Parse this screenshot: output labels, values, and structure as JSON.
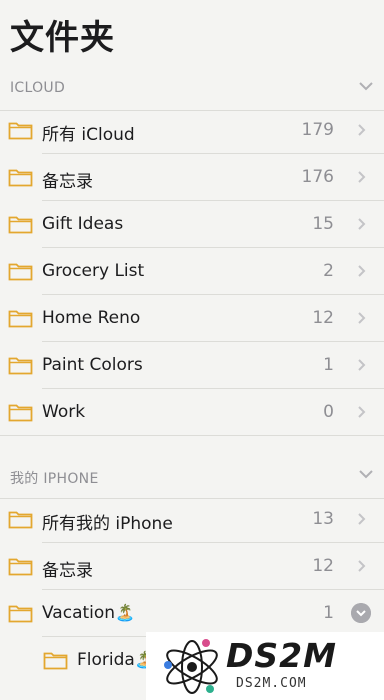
{
  "page": {
    "title": "文件夹"
  },
  "sections": [
    {
      "header": "ICLOUD",
      "folders": [
        {
          "name": "所有 iCloud",
          "count": "179"
        },
        {
          "name": "备忘录",
          "count": "176"
        },
        {
          "name": "Gift Ideas",
          "count": "15"
        },
        {
          "name": "Grocery List",
          "count": "2"
        },
        {
          "name": "Home Reno",
          "count": "12"
        },
        {
          "name": "Paint Colors",
          "count": "1"
        },
        {
          "name": "Work",
          "count": "0"
        }
      ]
    },
    {
      "header": "我的 IPHONE",
      "folders": [
        {
          "name": "所有我的 iPhone",
          "count": "13"
        },
        {
          "name": "备忘录",
          "count": "12"
        },
        {
          "name": "Vacation",
          "emoji": "🏝️",
          "count": "1",
          "expanded": true
        },
        {
          "name": "Florida",
          "emoji": "🏝️",
          "indent": true
        }
      ]
    }
  ],
  "watermark": {
    "brand": "DS2M",
    "site": "DS2M.COM"
  },
  "colors": {
    "folder_accent": "#e3a72f",
    "chevron": "#c4c4c7",
    "secondary_text": "#8e8e93"
  },
  "icons": {
    "folder": "folder-icon",
    "chevron": "chevron-right-icon",
    "collapse": "chevron-down-icon",
    "expand": "expand-circle-icon"
  }
}
